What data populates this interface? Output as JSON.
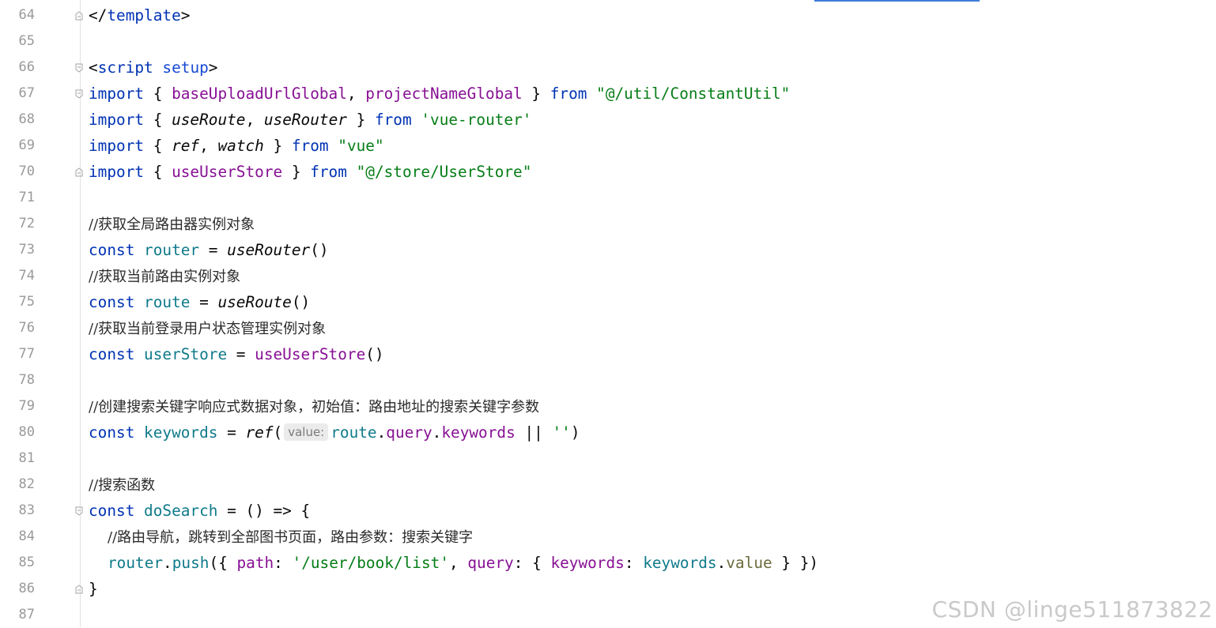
{
  "colors": {
    "keyword": "#0033b3",
    "string": "#067d17",
    "purple": "#871094",
    "teal": "#0f7a8a",
    "plain": "#080808",
    "line_number": "#999999"
  },
  "line_numbers": [
    "64",
    "65",
    "66",
    "67",
    "68",
    "69",
    "70",
    "71",
    "72",
    "73",
    "74",
    "75",
    "76",
    "77",
    "78",
    "79",
    "80",
    "81",
    "82",
    "83",
    "84",
    "85",
    "86",
    "87"
  ],
  "inlay_hint": "value:",
  "tokens": {
    "l64_open": "</",
    "l64_tag": "template",
    "l64_close": ">",
    "l66_open": "<",
    "l66_tag": "script",
    "l66_attr": "setup",
    "l66_close": ">",
    "l67_import": "import",
    "l67_lb": " { ",
    "l67_a": "baseUploadUrlGlobal",
    "l67_comma": ", ",
    "l67_b": "projectNameGlobal",
    "l67_rb": " } ",
    "l67_from": "from",
    "l67_sp": " ",
    "l67_src": "\"@/util/ConstantUtil\"",
    "l68_import": "import",
    "l68_lb": " { ",
    "l68_a": "useRoute",
    "l68_comma": ", ",
    "l68_b": "useRouter",
    "l68_rb": " } ",
    "l68_from": "from",
    "l68_sp": " ",
    "l68_src": "'vue-router'",
    "l69_import": "import",
    "l69_lb": " { ",
    "l69_a": "ref",
    "l69_comma": ", ",
    "l69_b": "watch",
    "l69_rb": " } ",
    "l69_from": "from",
    "l69_sp": " ",
    "l69_src": "\"vue\"",
    "l70_import": "import",
    "l70_lb": " { ",
    "l70_a": "useUserStore",
    "l70_rb": " } ",
    "l70_from": "from",
    "l70_sp": " ",
    "l70_src": "\"@/store/UserStore\"",
    "l72_comment": "//获取全局路由器实例对象",
    "l73_const": "const",
    "l73_var": " router",
    "l73_eq": " = ",
    "l73_fn": "useRouter",
    "l73_paren": "()",
    "l74_comment": "//获取当前路由实例对象",
    "l75_const": "const",
    "l75_var": " route",
    "l75_eq": " = ",
    "l75_fn": "useRoute",
    "l75_paren": "()",
    "l76_comment": "//获取当前登录用户状态管理实例对象",
    "l77_const": "const",
    "l77_var": " userStore",
    "l77_eq": " = ",
    "l77_fn": "useUserStore",
    "l77_paren": "()",
    "l79_comment": "//创建搜索关键字响应式数据对象，初始值：路由地址的搜索关键字参数",
    "l80_const": "const",
    "l80_var": " keywords",
    "l80_eq": " = ",
    "l80_fn": "ref",
    "l80_lp": "(",
    "l80_route": "route",
    "l80_dot1": ".",
    "l80_query": "query",
    "l80_dot2": ".",
    "l80_kw": "keywords",
    "l80_or": " || ",
    "l80_empty": "''",
    "l80_rp": ")",
    "l82_comment": "//搜索函数",
    "l83_const": "const",
    "l83_name": " doSearch",
    "l83_rest": " = () => {",
    "l84_comment": "//路由导航，跳转到全部图书页面，路由参数：搜索关键字",
    "l85_router": "router",
    "l85_dot": ".",
    "l85_push": "push",
    "l85_lb": "({ ",
    "l85_path": "path",
    "l85_colon1": ": ",
    "l85_pathval": "'/user/book/list'",
    "l85_comma": ", ",
    "l85_query": "query",
    "l85_colon2": ": { ",
    "l85_keywords": "keywords",
    "l85_colon3": ": ",
    "l85_kwvar": "keywords",
    "l85_dot2": ".",
    "l85_value": "value",
    "l85_end": " } })",
    "l86_brace": "}"
  },
  "watermark": "CSDN @linge511873822"
}
